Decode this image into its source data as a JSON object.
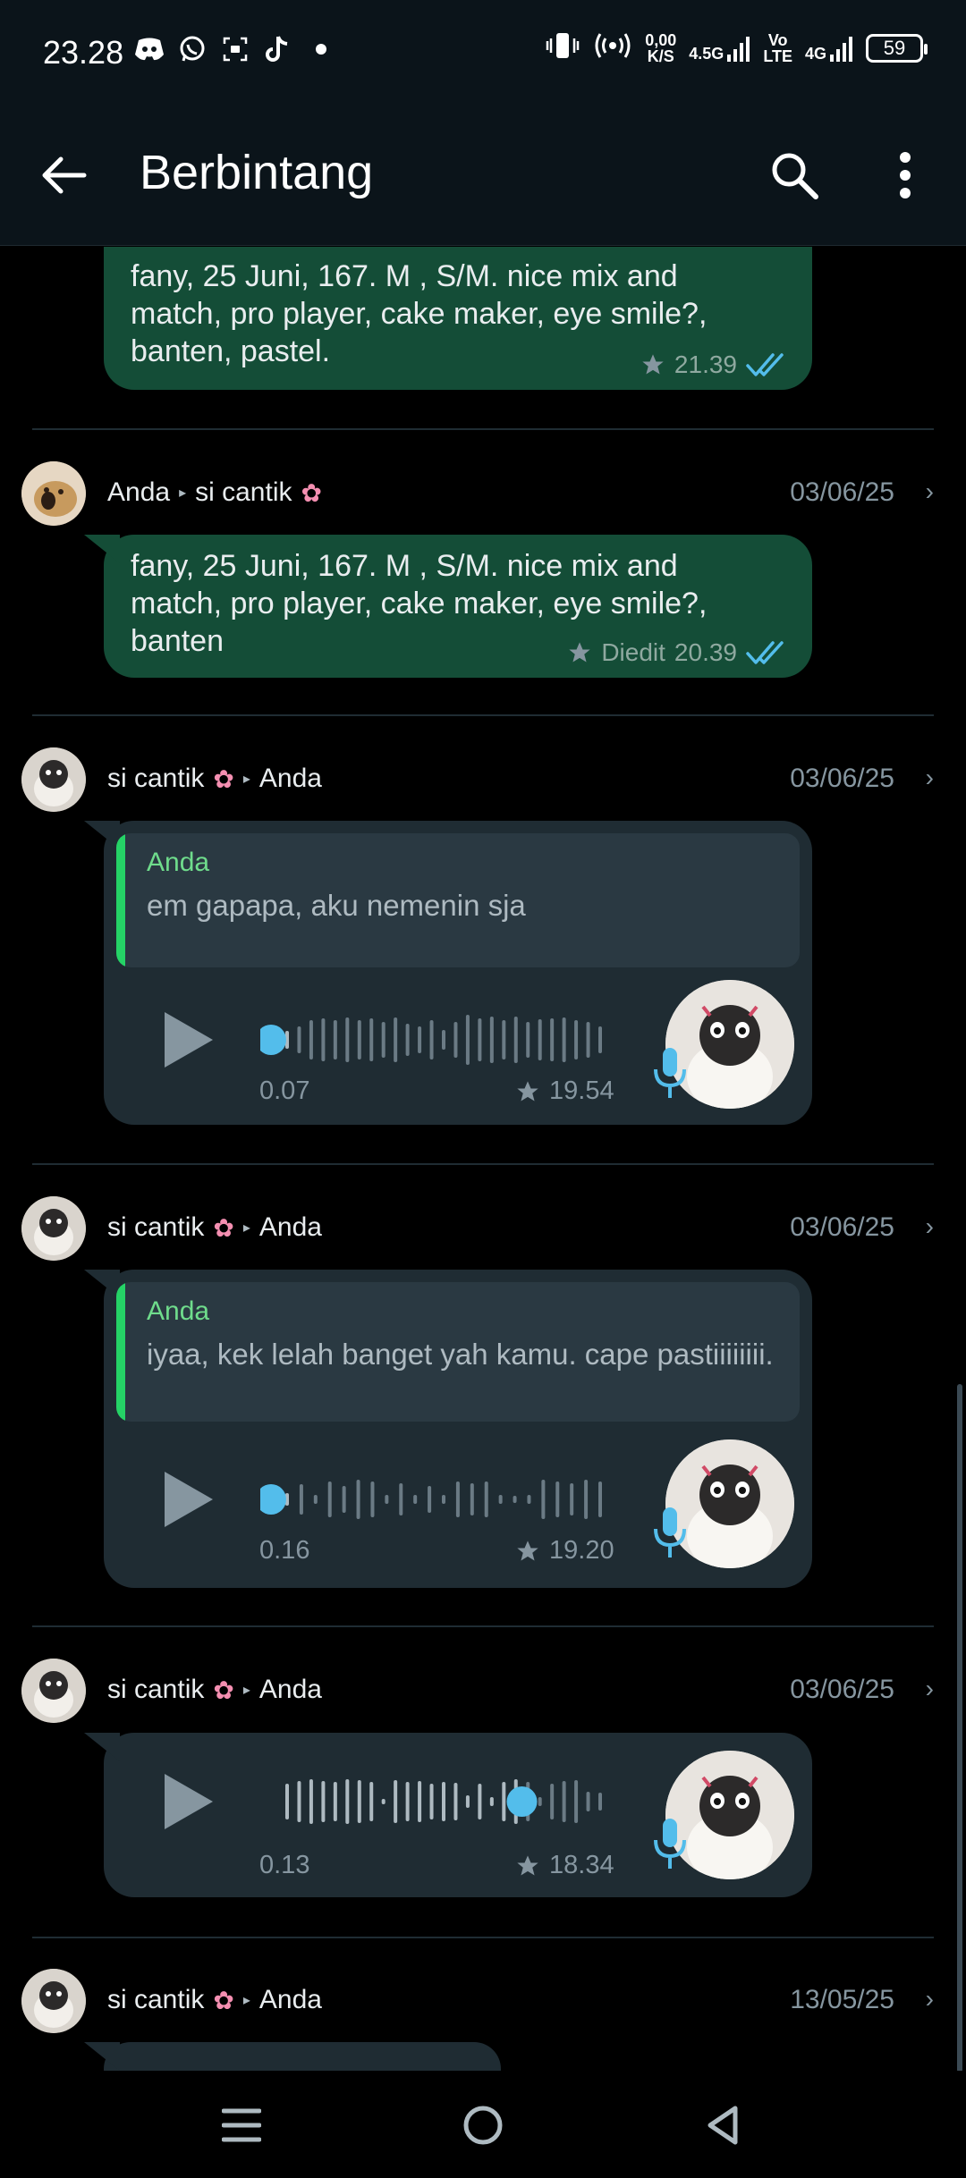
{
  "status_bar": {
    "time": "23.28",
    "net_speed_top": "0,00",
    "net_speed_bottom": "K/S",
    "net_type_1": "4.5G",
    "volte_top": "Vo",
    "volte_bottom": "LTE",
    "net_type_2": "4G",
    "battery": "59"
  },
  "app_bar": {
    "title": "Berbintang"
  },
  "messages": [
    {
      "text": "fany, 25 Juni, 167. M , S/M. nice mix and match, pro player, cake maker, eye smile?, banten, pastel.",
      "time": "21.39"
    },
    {
      "sender": "Anda",
      "recipient": "si cantik",
      "date": "03/06/25",
      "text": "fany, 25 Juni, 167. M , S/M. nice mix and match, pro player, cake maker, eye smile?, banten",
      "edited": "Diedit",
      "time": "20.39"
    },
    {
      "sender": "si cantik",
      "recipient": "Anda",
      "date": "03/06/25",
      "quote_name": "Anda",
      "quote_text": "em gapapa, aku nemenin sja",
      "duration": "0.07",
      "time": "19.54"
    },
    {
      "sender": "si cantik",
      "recipient": "Anda",
      "date": "03/06/25",
      "quote_name": "Anda",
      "quote_text": "iyaa, kek lelah banget yah kamu. cape pastiiiiiiii.",
      "duration": "0.16",
      "time": "19.20"
    },
    {
      "sender": "si cantik",
      "recipient": "Anda",
      "date": "03/06/25",
      "duration": "0.13",
      "time": "18.34",
      "progress": 0.75
    },
    {
      "sender": "si cantik",
      "recipient": "Anda",
      "date": "13/05/25"
    }
  ],
  "icons": {
    "back": "arrow-left-icon",
    "search": "search-icon",
    "menu": "more-vert-icon",
    "star": "star-icon",
    "double_check": "double-check-icon",
    "play": "play-icon",
    "mic": "mic-icon",
    "flower": "cherry-blossom-icon"
  },
  "colors": {
    "outgoing_bubble": "#144d37",
    "incoming_bubble": "#1f2c33",
    "read_tick": "#53bdeb",
    "quote_accent": "#25d366",
    "voice_dot": "#53bdeb"
  }
}
